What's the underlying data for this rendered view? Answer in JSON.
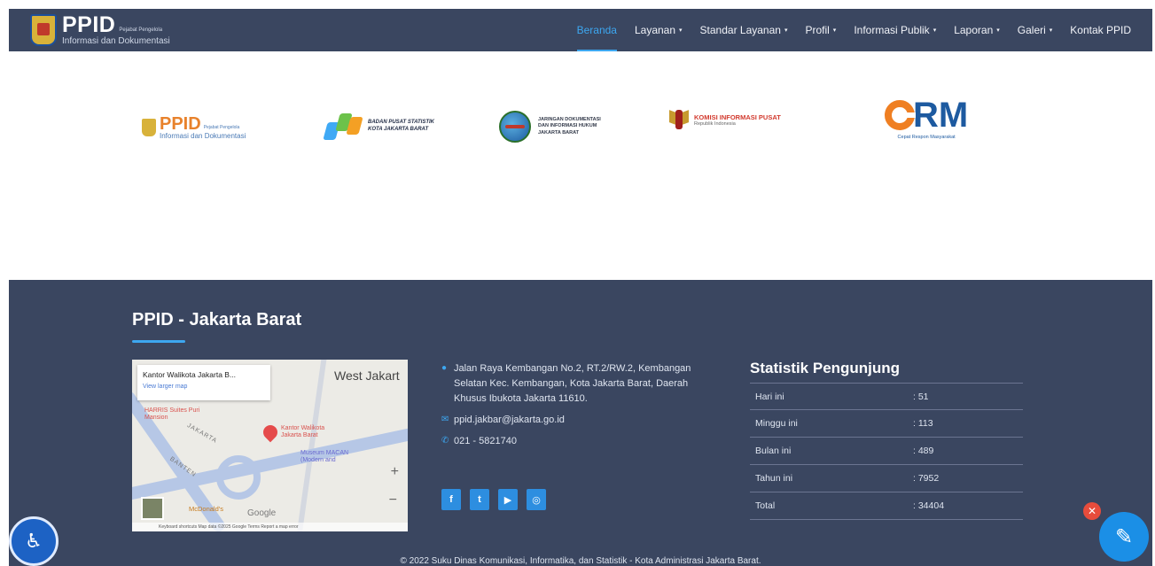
{
  "navbar": {
    "brand": {
      "title": "PPID",
      "subtitle_small": "Pejabat Pengelola",
      "subtitle": "Informasi dan Dokumentasi"
    },
    "menu": [
      {
        "label": "Beranda",
        "active": true,
        "dropdown": false
      },
      {
        "label": "Layanan",
        "active": false,
        "dropdown": true
      },
      {
        "label": "Standar Layanan",
        "active": false,
        "dropdown": true
      },
      {
        "label": "Profil",
        "active": false,
        "dropdown": true
      },
      {
        "label": "Informasi Publik",
        "active": false,
        "dropdown": true
      },
      {
        "label": "Laporan",
        "active": false,
        "dropdown": true
      },
      {
        "label": "Galeri",
        "active": false,
        "dropdown": true
      },
      {
        "label": "Kontak PPID",
        "active": false,
        "dropdown": false
      }
    ],
    "caret": "▾"
  },
  "partners": {
    "ppid": {
      "title": "PPID",
      "small": "Pejabat Pengelola",
      "subtitle": "Informasi dan Dokumentasi"
    },
    "bps": {
      "line1": "BADAN PUSAT STATISTIK",
      "line2": "KOTA JAKARTA BARAT"
    },
    "jdih": {
      "line1": "JARINGAN DOKUMENTASI",
      "line2": "DAN INFORMASI HUKUM",
      "line3": "JAKARTA BARAT"
    },
    "kip": {
      "line1": "KOMISI INFORMASI PUSAT",
      "line2": "Republik Indonesia"
    },
    "crm": {
      "mark": "RM",
      "subtitle": "Cepat Respon Masyarakat"
    }
  },
  "footer": {
    "title": "PPID - Jakarta Barat",
    "map": {
      "place": "Kantor Walikota Jakarta B...",
      "link": "View larger map",
      "area": "West Jakart",
      "pin_label": "Kantor Walikota Jakarta Barat",
      "harris": "HARRIS Suites Puri Mansion",
      "museum": "Museum MACAN (Modern and",
      "jakarta": "JAKARTA",
      "banten": "BANTEN",
      "mcdonalds": "McDonald's",
      "google": "Google",
      "zoom_in": "+",
      "zoom_out": "−",
      "attribution": "Keyboard shortcuts   Map data ©2025 Google   Terms   Report a map error"
    },
    "contact": {
      "address": "Jalan Raya Kembangan No.2, RT.2/RW.2, Kembangan Selatan Kec. Kembangan, Kota Jakarta Barat, Daerah Khusus Ibukota Jakarta 11610.",
      "email": "ppid.jakbar@jakarta.go.id",
      "phone": "021 - 5821740"
    },
    "socials": [
      {
        "name": "facebook-icon",
        "glyph": "f"
      },
      {
        "name": "twitter-icon",
        "glyph": "t"
      },
      {
        "name": "youtube-icon",
        "glyph": "▶"
      },
      {
        "name": "instagram-icon",
        "glyph": "◎"
      }
    ],
    "stats": {
      "title": "Statistik Pengunjung",
      "rows": [
        {
          "label": "Hari ini",
          "value": ": 51"
        },
        {
          "label": "Minggu ini",
          "value": ": 113"
        },
        {
          "label": "Bulan ini",
          "value": ": 489"
        },
        {
          "label": "Tahun ini",
          "value": ": 7952"
        },
        {
          "label": "Total",
          "value": ": 34404"
        }
      ]
    },
    "copyright": "© 2022 Suku Dinas Komunikasi, Informatika, dan Statistik - Kota Administrasi Jakarta Barat."
  },
  "colors": {
    "nav_bg": "#3a4660",
    "accent": "#3da7f0",
    "footer_bg": "#3a4660"
  }
}
